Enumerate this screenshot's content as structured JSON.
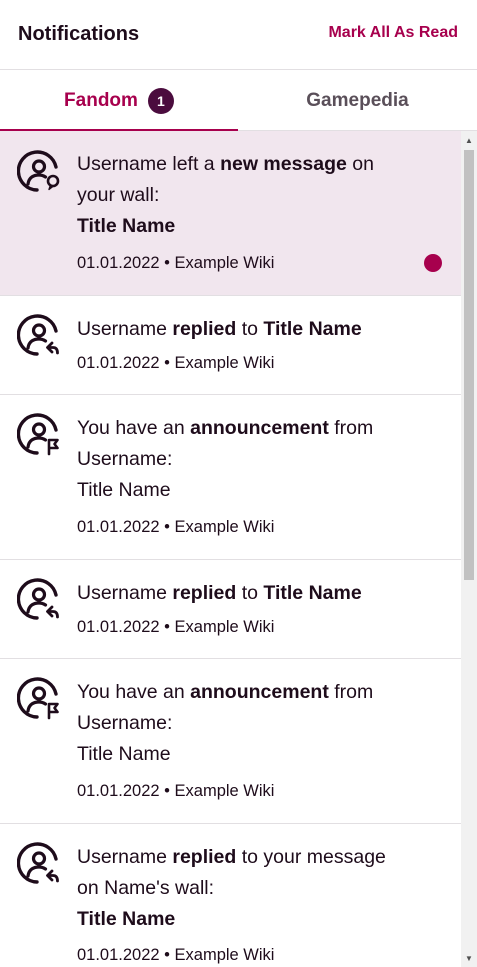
{
  "header": {
    "title": "Notifications",
    "mark_all_label": "Mark All As Read"
  },
  "tabs": [
    {
      "label": "Fandom",
      "badge": "1",
      "active": true
    },
    {
      "label": "Gamepedia",
      "active": false
    }
  ],
  "colors": {
    "accent": "#a7004d",
    "badge_bg": "#4b0c3e",
    "unread_bg": "#f1e6ee"
  },
  "notifications": [
    {
      "icon": "user-message-icon",
      "unread": true,
      "line1_pre": "Username left a ",
      "line1_bold": "new message",
      "line1_post": " on",
      "line2": "your wall:",
      "line3": "Title Name",
      "meta": "01.01.2022 • Example Wiki"
    },
    {
      "icon": "user-reply-icon",
      "unread": false,
      "pre": "Username ",
      "bold1": "replied",
      "mid": " to ",
      "bold2": "Title Name",
      "meta": "01.01.2022 • Example Wiki"
    },
    {
      "icon": "user-announcement-icon",
      "unread": false,
      "line1_pre": "You have an ",
      "line1_bold": "announcement",
      "line1_post": " from",
      "line2": "Username:",
      "line3": "Title Name",
      "meta": "01.01.2022 • Example Wiki"
    },
    {
      "icon": "user-reply-icon",
      "unread": false,
      "pre": "Username ",
      "bold1": "replied",
      "mid": " to ",
      "bold2": "Title Name",
      "meta": "01.01.2022 • Example Wiki"
    },
    {
      "icon": "user-announcement-icon",
      "unread": false,
      "line1_pre": "You have an ",
      "line1_bold": "announcement",
      "line1_post": " from",
      "line2": "Username:",
      "line3": "Title Name",
      "meta": "01.01.2022 • Example Wiki"
    },
    {
      "icon": "user-reply-icon",
      "unread": false,
      "line1_pre": "Username ",
      "line1_bold": "replied",
      "line1_post": " to your message",
      "line2": "on Name's wall:",
      "line3": "Title Name",
      "meta": "01.01.2022 • Example Wiki"
    }
  ]
}
